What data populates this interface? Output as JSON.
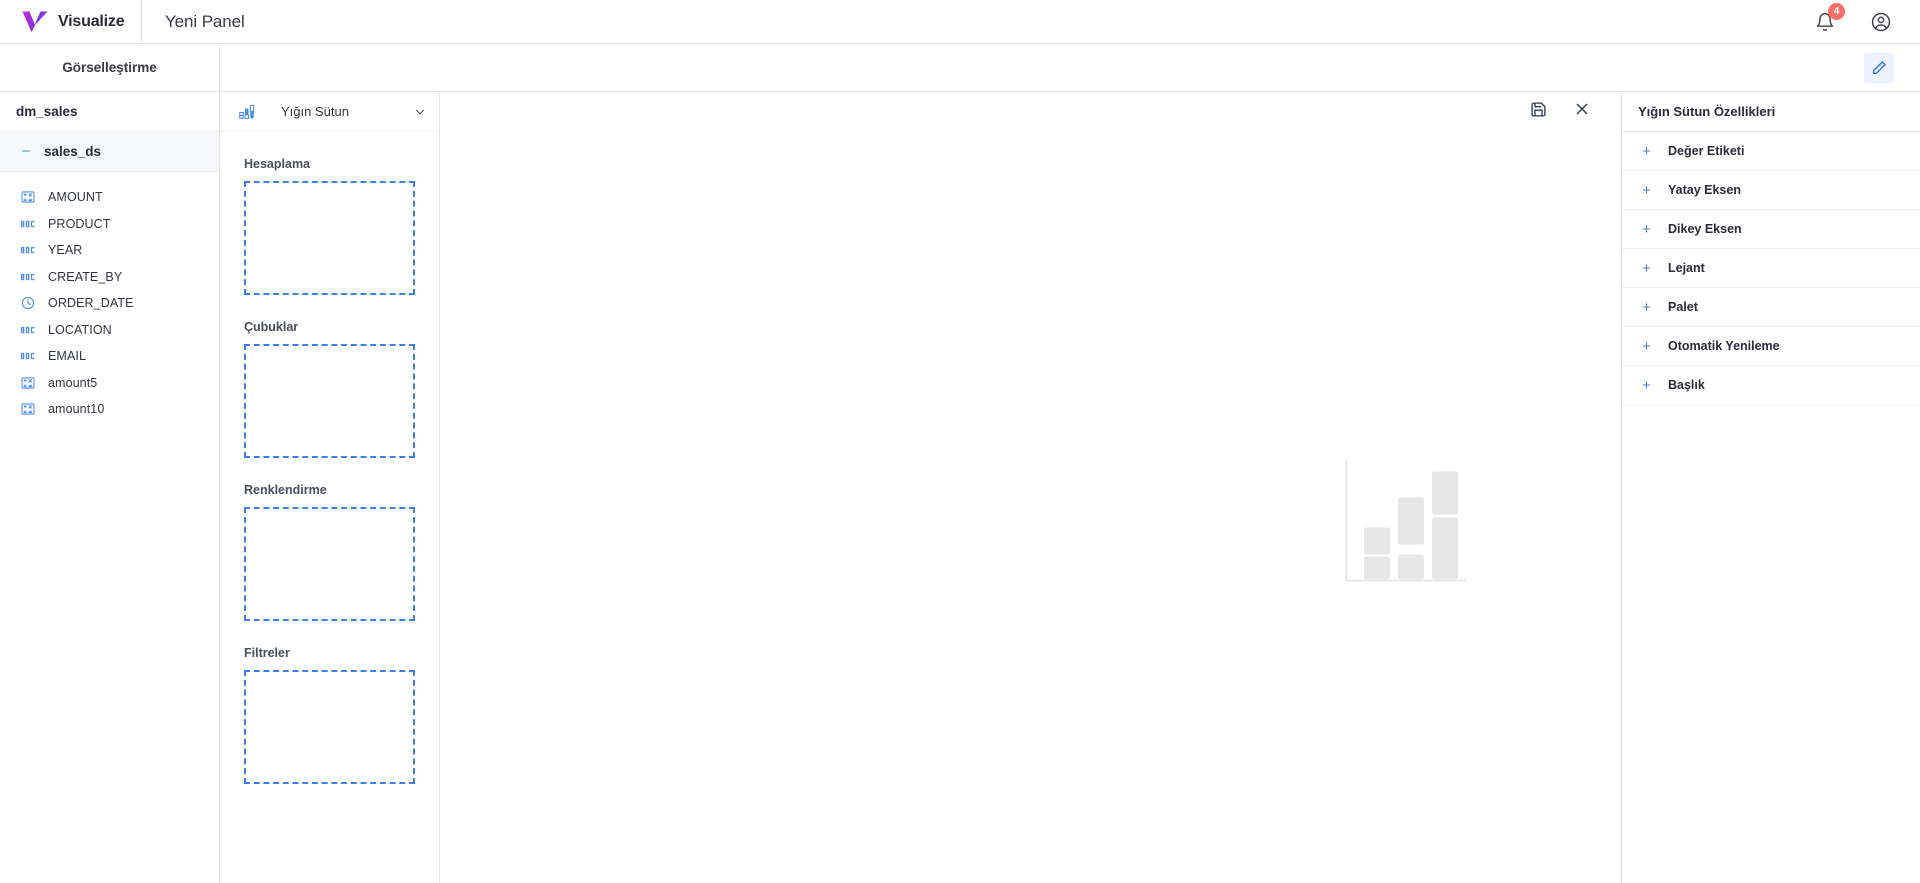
{
  "topbar": {
    "brand_name": "Visualize",
    "logo_icon": "v-logo-icon",
    "panel_title": "Yeni Panel",
    "notification_icon": "bell-icon",
    "notification_count": "4",
    "account_icon": "account-circle-icon"
  },
  "subbar": {
    "visualization_label": "Görselleştirme",
    "edit_icon": "pencil-icon"
  },
  "data_sidebar": {
    "datasource_name": "dm_sales",
    "dataset": {
      "name": "sales_ds",
      "collapse_icon": "minus-icon",
      "expanded": true
    },
    "fields": [
      {
        "label": "AMOUNT",
        "icon": "measure-numeric-icon",
        "type": "measure"
      },
      {
        "label": "PRODUCT",
        "icon": "abc-text-icon",
        "type": "text"
      },
      {
        "label": "YEAR",
        "icon": "abc-text-icon",
        "type": "text"
      },
      {
        "label": "CREATE_BY",
        "icon": "abc-text-icon",
        "type": "text"
      },
      {
        "label": "ORDER_DATE",
        "icon": "clock-date-icon",
        "type": "date"
      },
      {
        "label": "LOCATION",
        "icon": "abc-text-icon",
        "type": "text"
      },
      {
        "label": "EMAIL",
        "icon": "abc-text-icon",
        "type": "text"
      },
      {
        "label": "amount5",
        "icon": "measure-numeric-icon",
        "type": "measure"
      },
      {
        "label": "amount10",
        "icon": "measure-numeric-icon",
        "type": "measure"
      }
    ]
  },
  "config_panel": {
    "chart_type": {
      "label": "Yığın Sütun",
      "icon": "stacked-column-chart-icon",
      "caret_icon": "chevron-down-icon"
    },
    "dropzones": [
      {
        "label": "Hesaplama",
        "value": ""
      },
      {
        "label": "Çubuklar",
        "value": ""
      },
      {
        "label": "Renklendirme",
        "value": ""
      },
      {
        "label": "Filtreler",
        "value": ""
      }
    ]
  },
  "canvas": {
    "save_icon": "save-floppy-icon",
    "close_icon": "close-x-icon",
    "placeholder_icon": "stacked-column-placeholder-icon"
  },
  "props_panel": {
    "header": "Yığın Sütun Özellikleri",
    "items": [
      {
        "label": "Değer Etiketi",
        "icon": "plus-icon"
      },
      {
        "label": "Yatay Eksen",
        "icon": "plus-icon"
      },
      {
        "label": "Dikey Eksen",
        "icon": "plus-icon"
      },
      {
        "label": "Lejant",
        "icon": "plus-icon"
      },
      {
        "label": "Palet",
        "icon": "plus-icon"
      },
      {
        "label": "Otomatik Yenileme",
        "icon": "plus-icon"
      },
      {
        "label": "Başlık",
        "icon": "plus-icon"
      }
    ]
  },
  "colors": {
    "accent_blue": "#3d7df0",
    "field_icon_blue": "#4a8af4",
    "badge_red": "#f9706b",
    "logo_purple": "#9b2fd4",
    "logo_blue": "#2f5bd4",
    "border": "#e4e6ea",
    "placeholder_gray": "#e6e6e6"
  }
}
